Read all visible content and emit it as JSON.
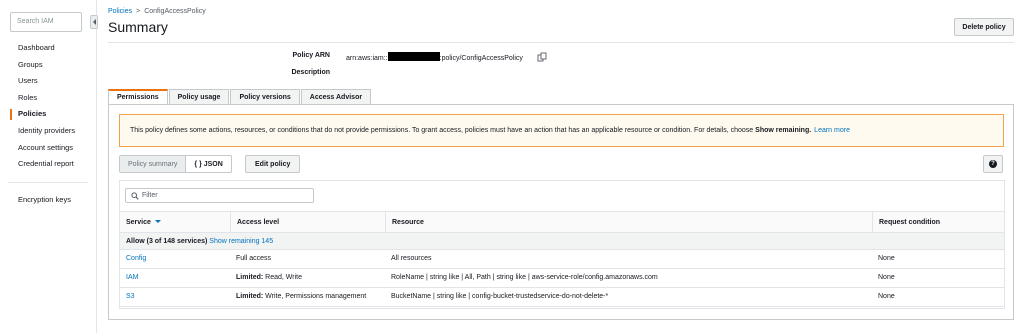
{
  "sidebar": {
    "search_placeholder": "Search IAM",
    "items": [
      {
        "label": "Dashboard"
      },
      {
        "label": "Groups"
      },
      {
        "label": "Users"
      },
      {
        "label": "Roles"
      },
      {
        "label": "Policies",
        "active": true
      },
      {
        "label": "Identity providers"
      },
      {
        "label": "Account settings"
      },
      {
        "label": "Credential report"
      },
      {
        "label": "Encryption keys"
      }
    ]
  },
  "breadcrumb": {
    "parent": "Policies",
    "separator": ">",
    "current": "ConfigAccessPolicy"
  },
  "header": {
    "title": "Summary",
    "delete_label": "Delete policy"
  },
  "summary": {
    "arn_label": "Policy ARN",
    "arn_prefix": "arn:aws:iam::",
    "arn_suffix": ":policy/ConfigAccessPolicy",
    "description_label": "Description"
  },
  "tabs": [
    {
      "label": "Permissions",
      "active": true
    },
    {
      "label": "Policy usage"
    },
    {
      "label": "Policy versions"
    },
    {
      "label": "Access Advisor"
    }
  ],
  "alert": {
    "text": "This policy defines some actions, resources, or conditions that do not provide permissions. To grant access, policies must have an action that has an applicable resource or condition. For details, choose",
    "bold": "Show remaining.",
    "link": "Learn more"
  },
  "toolbar": {
    "summary_label": "Policy summary",
    "json_label": "{ } JSON",
    "edit_label": "Edit policy",
    "help_label": "?"
  },
  "table": {
    "filter_placeholder": "Filter",
    "columns": [
      "Service",
      "Access level",
      "Resource",
      "Request condition"
    ],
    "group_label": "Allow (3 of 148 services)",
    "group_link": "Show remaining 145",
    "rows": [
      {
        "service": "Config",
        "access_bold": "",
        "access": "Full access",
        "resource": "All resources",
        "condition": "None"
      },
      {
        "service": "IAM",
        "access_bold": "Limited:",
        "access": " Read, Write",
        "resource": "RoleName | string like | All, Path | string like | aws-service-role/config.amazonaws.com",
        "condition": "None"
      },
      {
        "service": "S3",
        "access_bold": "Limited:",
        "access": " Write, Permissions management",
        "resource": "BucketName | string like | config-bucket-trustedservice-do-not-delete-*",
        "condition": "None"
      }
    ]
  },
  "colors": {
    "accent": "#ec7211",
    "link": "#0073bb",
    "alert_border": "#f0a34a"
  }
}
